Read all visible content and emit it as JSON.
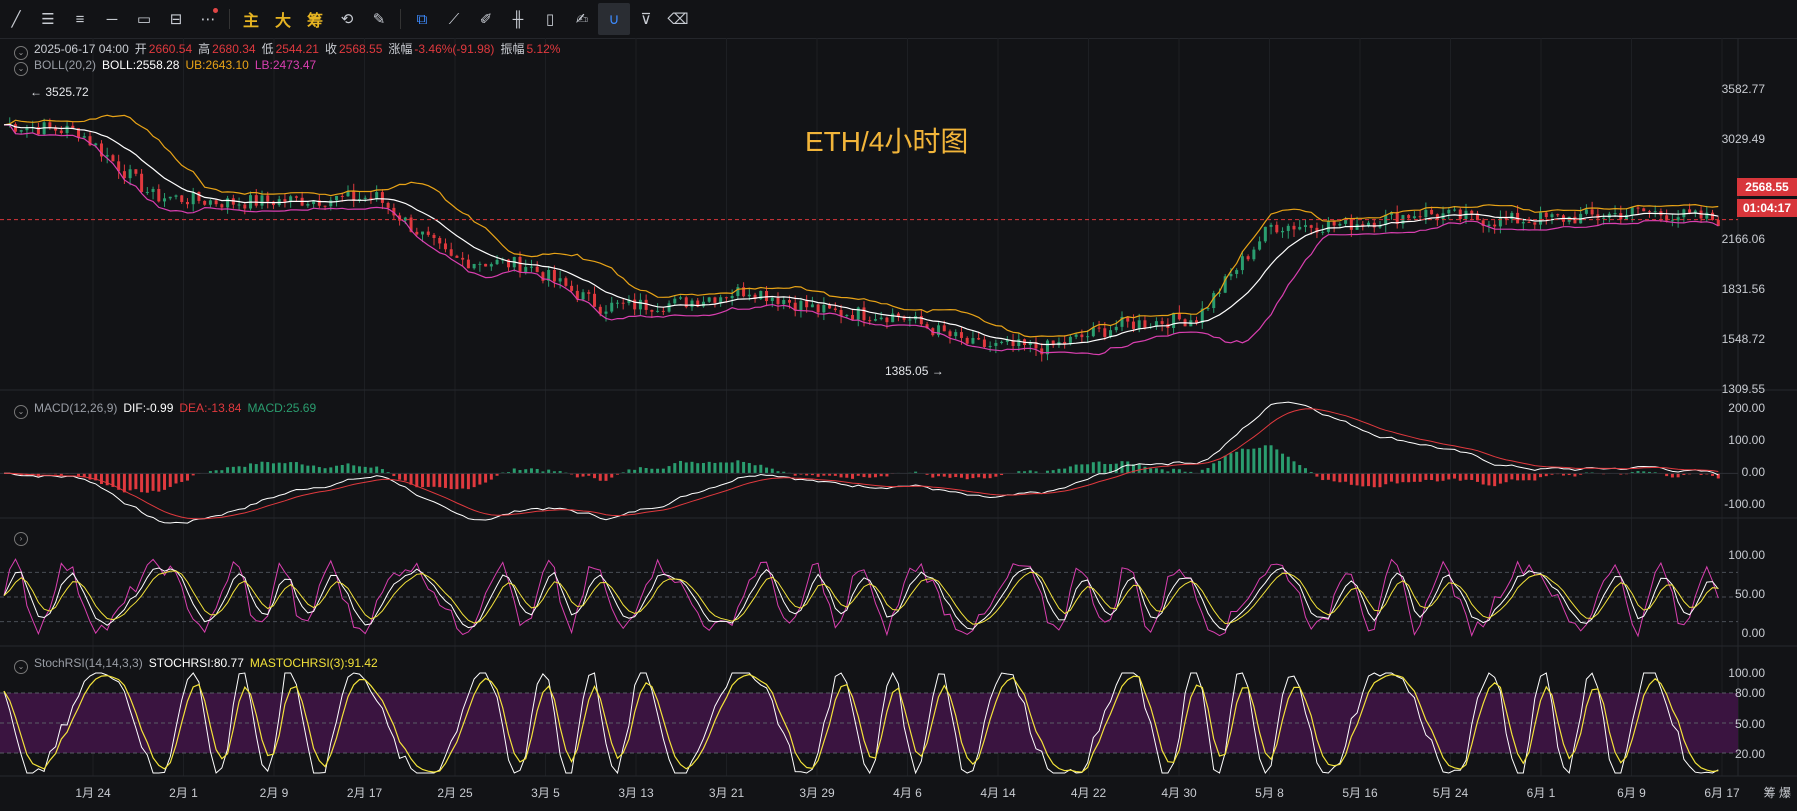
{
  "toolbar": {
    "icons": [
      "line-tool-icon",
      "parallel-lines-icon",
      "multi-line-icon",
      "horizontal-line-icon",
      "rectangle-icon",
      "measure-icon",
      "more-icon",
      "text-main",
      "text-big",
      "text-chip",
      "settings-cycle-icon",
      "brush-icon",
      "select-icon",
      "ruler-icon",
      "pen-icon",
      "candle-icon",
      "clipboard-icon",
      "note-icon",
      "magnet-icon",
      "filter-icon",
      "trash-icon"
    ],
    "text_buttons": [
      "主",
      "大",
      "筹"
    ]
  },
  "ohlc": {
    "date": "2025-06-17 04:00",
    "open_label": "开",
    "open": "2660.54",
    "high_label": "高",
    "high": "2680.34",
    "low_label": "低",
    "low": "2544.21",
    "close_label": "收",
    "close": "2568.55",
    "change_label": "涨幅",
    "change": "-3.46%(-91.98)",
    "amplitude_label": "振幅",
    "amplitude": "5.12%"
  },
  "boll": {
    "name": "BOLL(20,2)",
    "mid": "BOLL:2558.28",
    "ub": "UB:2643.10",
    "lb": "LB:2473.47"
  },
  "macd": {
    "name": "MACD(12,26,9)",
    "dif": "DIF:-0.99",
    "dea": "DEA:-13.84",
    "macd": "MACD:25.69"
  },
  "stochrsi": {
    "name": "StochRSI(14,14,3,3)",
    "k": "STOCHRSI:80.77",
    "d": "MASTOCHRSI(3):91.42"
  },
  "title_overlay": "ETH/4小时图",
  "high_annotation": "3525.72",
  "low_annotation": "1385.05",
  "price_axis": [
    "3582.77",
    "3029.49",
    "2166.06",
    "1831.56",
    "1548.72",
    "1309.55"
  ],
  "current_price": "2568.55",
  "countdown": "01:04:17",
  "macd_axis": [
    "200.00",
    "100.00",
    "0.00",
    "-100.00"
  ],
  "kdj_axis": [
    "100.00",
    "50.00",
    "0.00"
  ],
  "stoch_axis": [
    "100.00",
    "80.00",
    "50.00",
    "20.00"
  ],
  "x_axis": [
    "1月 24",
    "2月 1",
    "2月 9",
    "2月 17",
    "2月 25",
    "3月 5",
    "3月 13",
    "3月 21",
    "3月 29",
    "4月 6",
    "4月 14",
    "4月 22",
    "4月 30",
    "5月 8",
    "5月 16",
    "5月 24",
    "6月 1",
    "6月 9",
    "6月 17"
  ],
  "corner_labels": [
    "筹",
    "爆"
  ],
  "colors": {
    "up": "#2a9d6f",
    "down": "#e0393e",
    "ub": "#e8a317",
    "lb": "#d93fb0",
    "mid": "#ffffff",
    "price_line": "#d8363b",
    "stoch_fill": "#3a1440",
    "title": "#f2b53a"
  },
  "chart_data": {
    "type": "line",
    "title": "ETH/4小时图",
    "x_ticks": [
      "1月 24",
      "2月 1",
      "2月 9",
      "2月 17",
      "2月 25",
      "3月 5",
      "3月 13",
      "3月 21",
      "3月 29",
      "4月 6",
      "4月 14",
      "4月 22",
      "4月 30",
      "5月 8",
      "5月 16",
      "5月 24",
      "6月 1",
      "6月 9",
      "6月 17"
    ],
    "price_close": [
      3300,
      3250,
      2750,
      2700,
      2720,
      2740,
      2260,
      2220,
      1900,
      1920,
      2030,
      1860,
      1830,
      1600,
      1580,
      1760,
      1810,
      2520,
      2530,
      2620,
      2560,
      2580,
      2630,
      2568.55
    ],
    "boll_series": [
      {
        "name": "UB",
        "color": "#e8a317"
      },
      {
        "name": "BOLL",
        "color": "#ffffff"
      },
      {
        "name": "LB",
        "color": "#d93fb0"
      }
    ],
    "y_range": [
      1309.55,
      3582.77
    ],
    "high_marker": 3525.72,
    "low_marker": 1385.05,
    "last_price": 2568.55,
    "macd_range": [
      -100,
      200
    ],
    "stochrsi_levels": [
      20,
      50,
      80
    ]
  }
}
